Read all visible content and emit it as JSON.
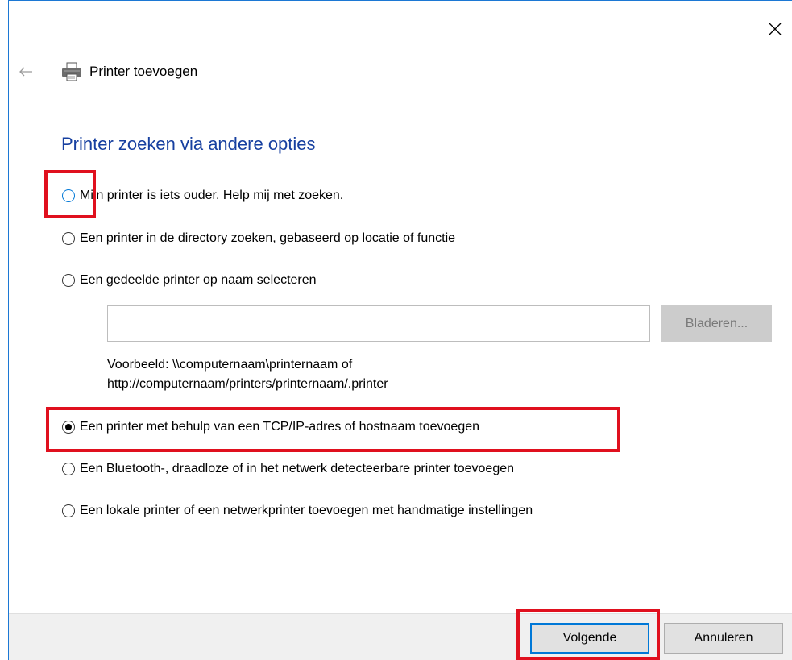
{
  "window": {
    "title": "Printer toevoegen"
  },
  "heading": "Printer zoeken via andere opties",
  "options": [
    {
      "label": "Mijn printer is iets ouder. Help mij met zoeken.",
      "selected": false
    },
    {
      "label": "Een printer in de directory zoeken, gebaseerd op locatie of functie",
      "selected": false
    },
    {
      "label": "Een gedeelde printer op naam selecteren",
      "selected": false
    },
    {
      "label": "Een printer met behulp van een TCP/IP-adres of hostnaam toevoegen",
      "selected": true
    },
    {
      "label": "Een Bluetooth-, draadloze of in het netwerk detecteerbare printer toevoegen",
      "selected": false
    },
    {
      "label": "Een lokale printer of een netwerkprinter toevoegen met handmatige instellingen",
      "selected": false
    }
  ],
  "shared_printer": {
    "input_value": "",
    "browse_label": "Bladeren...",
    "example_line1": "Voorbeeld: \\\\computernaam\\printernaam of",
    "example_line2": "http://computernaam/printers/printernaam/.printer"
  },
  "buttons": {
    "next": "Volgende",
    "cancel": "Annuleren"
  },
  "colors": {
    "accent": "#0078d7",
    "heading": "#1740a0",
    "highlight": "#e0101e"
  }
}
